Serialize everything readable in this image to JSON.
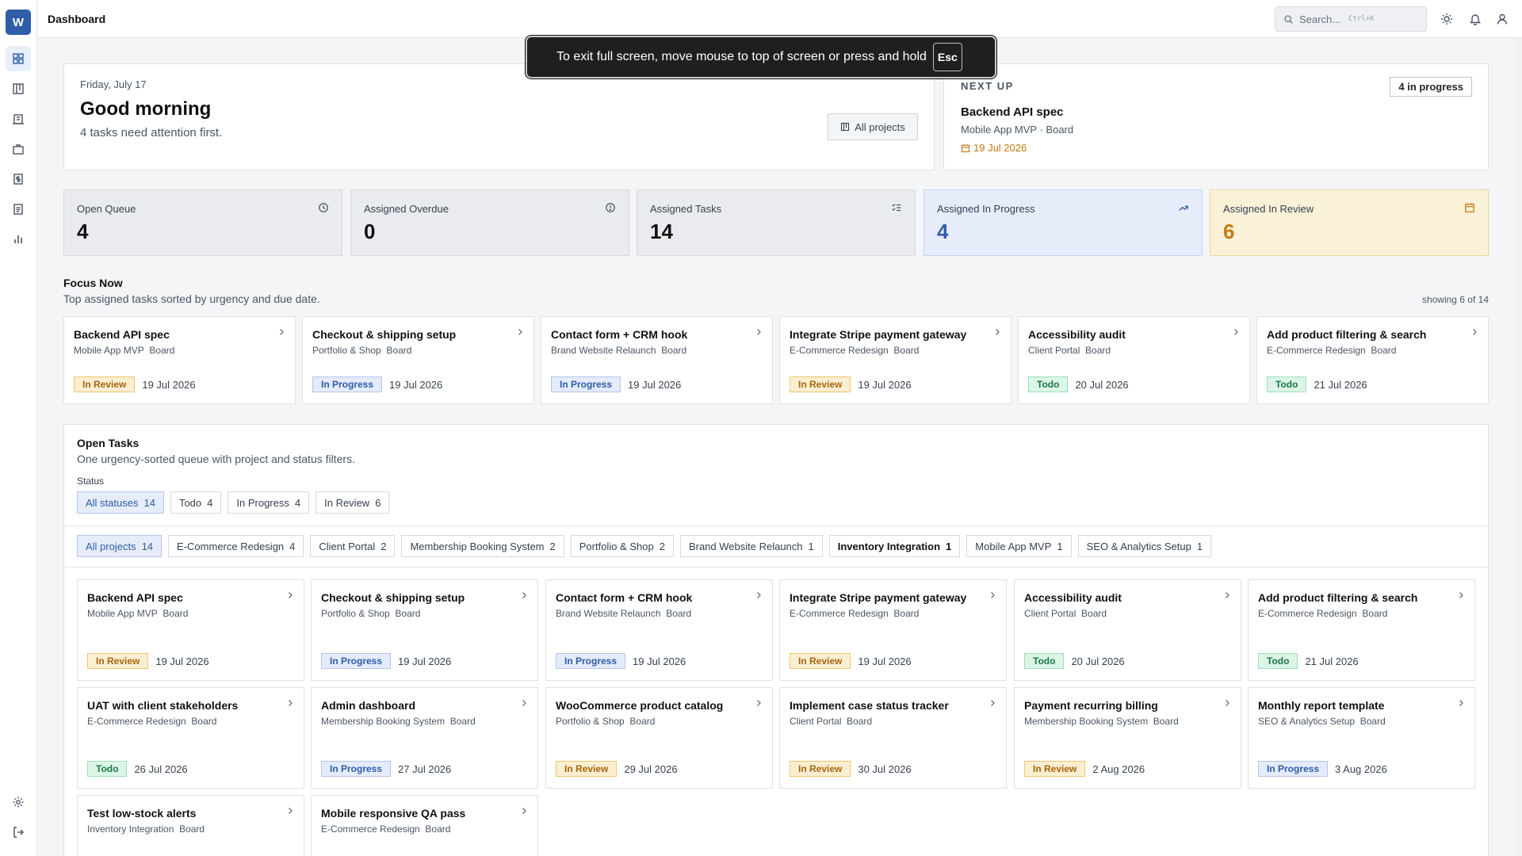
{
  "app": {
    "logo_letter": "W",
    "page_title": "Dashboard"
  },
  "sidebar": {
    "items": [
      {
        "icon": "dashboard-grid-icon",
        "active": true
      },
      {
        "icon": "board-icon"
      },
      {
        "icon": "building-icon"
      },
      {
        "icon": "briefcase-icon"
      },
      {
        "icon": "invoice-icon"
      },
      {
        "icon": "document-icon"
      },
      {
        "icon": "bar-chart-icon"
      },
      {
        "icon": "gear-icon"
      },
      {
        "icon": "logout-icon"
      }
    ]
  },
  "topbar": {
    "search_placeholder": "Search...",
    "search_shortcut": "Ctrl+K"
  },
  "toast": {
    "text": "To exit full screen, move mouse to top of screen or press and hold",
    "key": "Esc"
  },
  "hero": {
    "date": "Friday, July 17",
    "greeting": "Good morning",
    "subtitle": "4 tasks need attention first.",
    "all_projects_label": "All projects"
  },
  "next_up": {
    "label": "NEXT UP",
    "badge": "4 in progress",
    "title": "Backend API spec",
    "meta": "Mobile App MVP  · Board",
    "due": "19 Jul 2026"
  },
  "stats": [
    {
      "label": "Open Queue",
      "value": "4",
      "icon": "clock-icon",
      "tone": "gray"
    },
    {
      "label": "Assigned Overdue",
      "value": "0",
      "icon": "alert-circle-icon",
      "tone": "gray"
    },
    {
      "label": "Assigned Tasks",
      "value": "14",
      "icon": "list-check-icon",
      "tone": "gray"
    },
    {
      "label": "Assigned In Progress",
      "value": "4",
      "icon": "trend-up-icon",
      "tone": "blue"
    },
    {
      "label": "Assigned In Review",
      "value": "6",
      "icon": "calendar-icon",
      "tone": "yellow"
    }
  ],
  "focus": {
    "title": "Focus Now",
    "subtitle": "Top assigned tasks sorted by urgency and due date.",
    "showing": "showing 6 of 14",
    "tasks": [
      {
        "title": "Backend API spec",
        "project": "Mobile App MVP",
        "board": "Board",
        "status": "In Review",
        "due": "19 Jul 2026"
      },
      {
        "title": "Checkout & shipping setup",
        "project": "Portfolio & Shop",
        "board": "Board",
        "status": "In Progress",
        "due": "19 Jul 2026"
      },
      {
        "title": "Contact form + CRM hook",
        "project": "Brand Website Relaunch",
        "board": "Board",
        "status": "In Progress",
        "due": "19 Jul 2026"
      },
      {
        "title": "Integrate Stripe payment gateway",
        "project": "E-Commerce Redesign",
        "board": "Board",
        "status": "In Review",
        "due": "19 Jul 2026"
      },
      {
        "title": "Accessibility audit",
        "project": "Client Portal",
        "board": "Board",
        "status": "Todo",
        "due": "20 Jul 2026"
      },
      {
        "title": "Add product filtering & search",
        "project": "E-Commerce Redesign",
        "board": "Board",
        "status": "Todo",
        "due": "21 Jul 2026"
      }
    ]
  },
  "open_tasks": {
    "title": "Open Tasks",
    "subtitle": "One urgency-sorted queue with project and status filters.",
    "status_label": "Status",
    "status_filters": [
      {
        "label": "All statuses",
        "count": "14",
        "active": true
      },
      {
        "label": "Todo",
        "count": "4"
      },
      {
        "label": "In Progress",
        "count": "4"
      },
      {
        "label": "In Review",
        "count": "6"
      }
    ],
    "project_filters": [
      {
        "label": "All projects",
        "count": "14",
        "active": true
      },
      {
        "label": "E-Commerce Redesign",
        "count": "4"
      },
      {
        "label": "Client Portal",
        "count": "2"
      },
      {
        "label": "Membership Booking System",
        "count": "2"
      },
      {
        "label": "Portfolio & Shop",
        "count": "2"
      },
      {
        "label": "Brand Website Relaunch",
        "count": "1"
      },
      {
        "label": "Inventory Integration",
        "count": "1",
        "bold": true
      },
      {
        "label": "Mobile App MVP",
        "count": "1"
      },
      {
        "label": "SEO & Analytics Setup",
        "count": "1"
      }
    ],
    "tasks": [
      {
        "title": "Backend API spec",
        "project": "Mobile App MVP",
        "board": "Board",
        "status": "In Review",
        "due": "19 Jul 2026"
      },
      {
        "title": "Checkout & shipping setup",
        "project": "Portfolio & Shop",
        "board": "Board",
        "status": "In Progress",
        "due": "19 Jul 2026"
      },
      {
        "title": "Contact form + CRM hook",
        "project": "Brand Website Relaunch",
        "board": "Board",
        "status": "In Progress",
        "due": "19 Jul 2026"
      },
      {
        "title": "Integrate Stripe payment gateway",
        "project": "E-Commerce Redesign",
        "board": "Board",
        "status": "In Review",
        "due": "19 Jul 2026"
      },
      {
        "title": "Accessibility audit",
        "project": "Client Portal",
        "board": "Board",
        "status": "Todo",
        "due": "20 Jul 2026"
      },
      {
        "title": "Add product filtering & search",
        "project": "E-Commerce Redesign",
        "board": "Board",
        "status": "Todo",
        "due": "21 Jul 2026"
      },
      {
        "title": "UAT with client stakeholders",
        "project": "E-Commerce Redesign",
        "board": "Board",
        "status": "Todo",
        "due": "26 Jul 2026"
      },
      {
        "title": "Admin dashboard",
        "project": "Membership Booking System",
        "board": "Board",
        "status": "In Progress",
        "due": "27 Jul 2026"
      },
      {
        "title": "WooCommerce product catalog",
        "project": "Portfolio & Shop",
        "board": "Board",
        "status": "In Review",
        "due": "29 Jul 2026"
      },
      {
        "title": "Implement case status tracker",
        "project": "Client Portal",
        "board": "Board",
        "status": "In Review",
        "due": "30 Jul 2026"
      },
      {
        "title": "Payment recurring billing",
        "project": "Membership Booking System",
        "board": "Board",
        "status": "In Review",
        "due": "2 Aug 2026"
      },
      {
        "title": "Monthly report template",
        "project": "SEO & Analytics Setup",
        "board": "Board",
        "status": "In Progress",
        "due": "3 Aug 2026"
      },
      {
        "title": "Test low-stock alerts",
        "project": "Inventory Integration",
        "board": "Board",
        "status": "",
        "due": ""
      },
      {
        "title": "Mobile responsive QA pass",
        "project": "E-Commerce Redesign",
        "board": "Board",
        "status": "",
        "due": ""
      }
    ]
  },
  "colors": {
    "accent": "#2f5da8",
    "review": "#c27a12",
    "todo": "#1a7a45"
  }
}
